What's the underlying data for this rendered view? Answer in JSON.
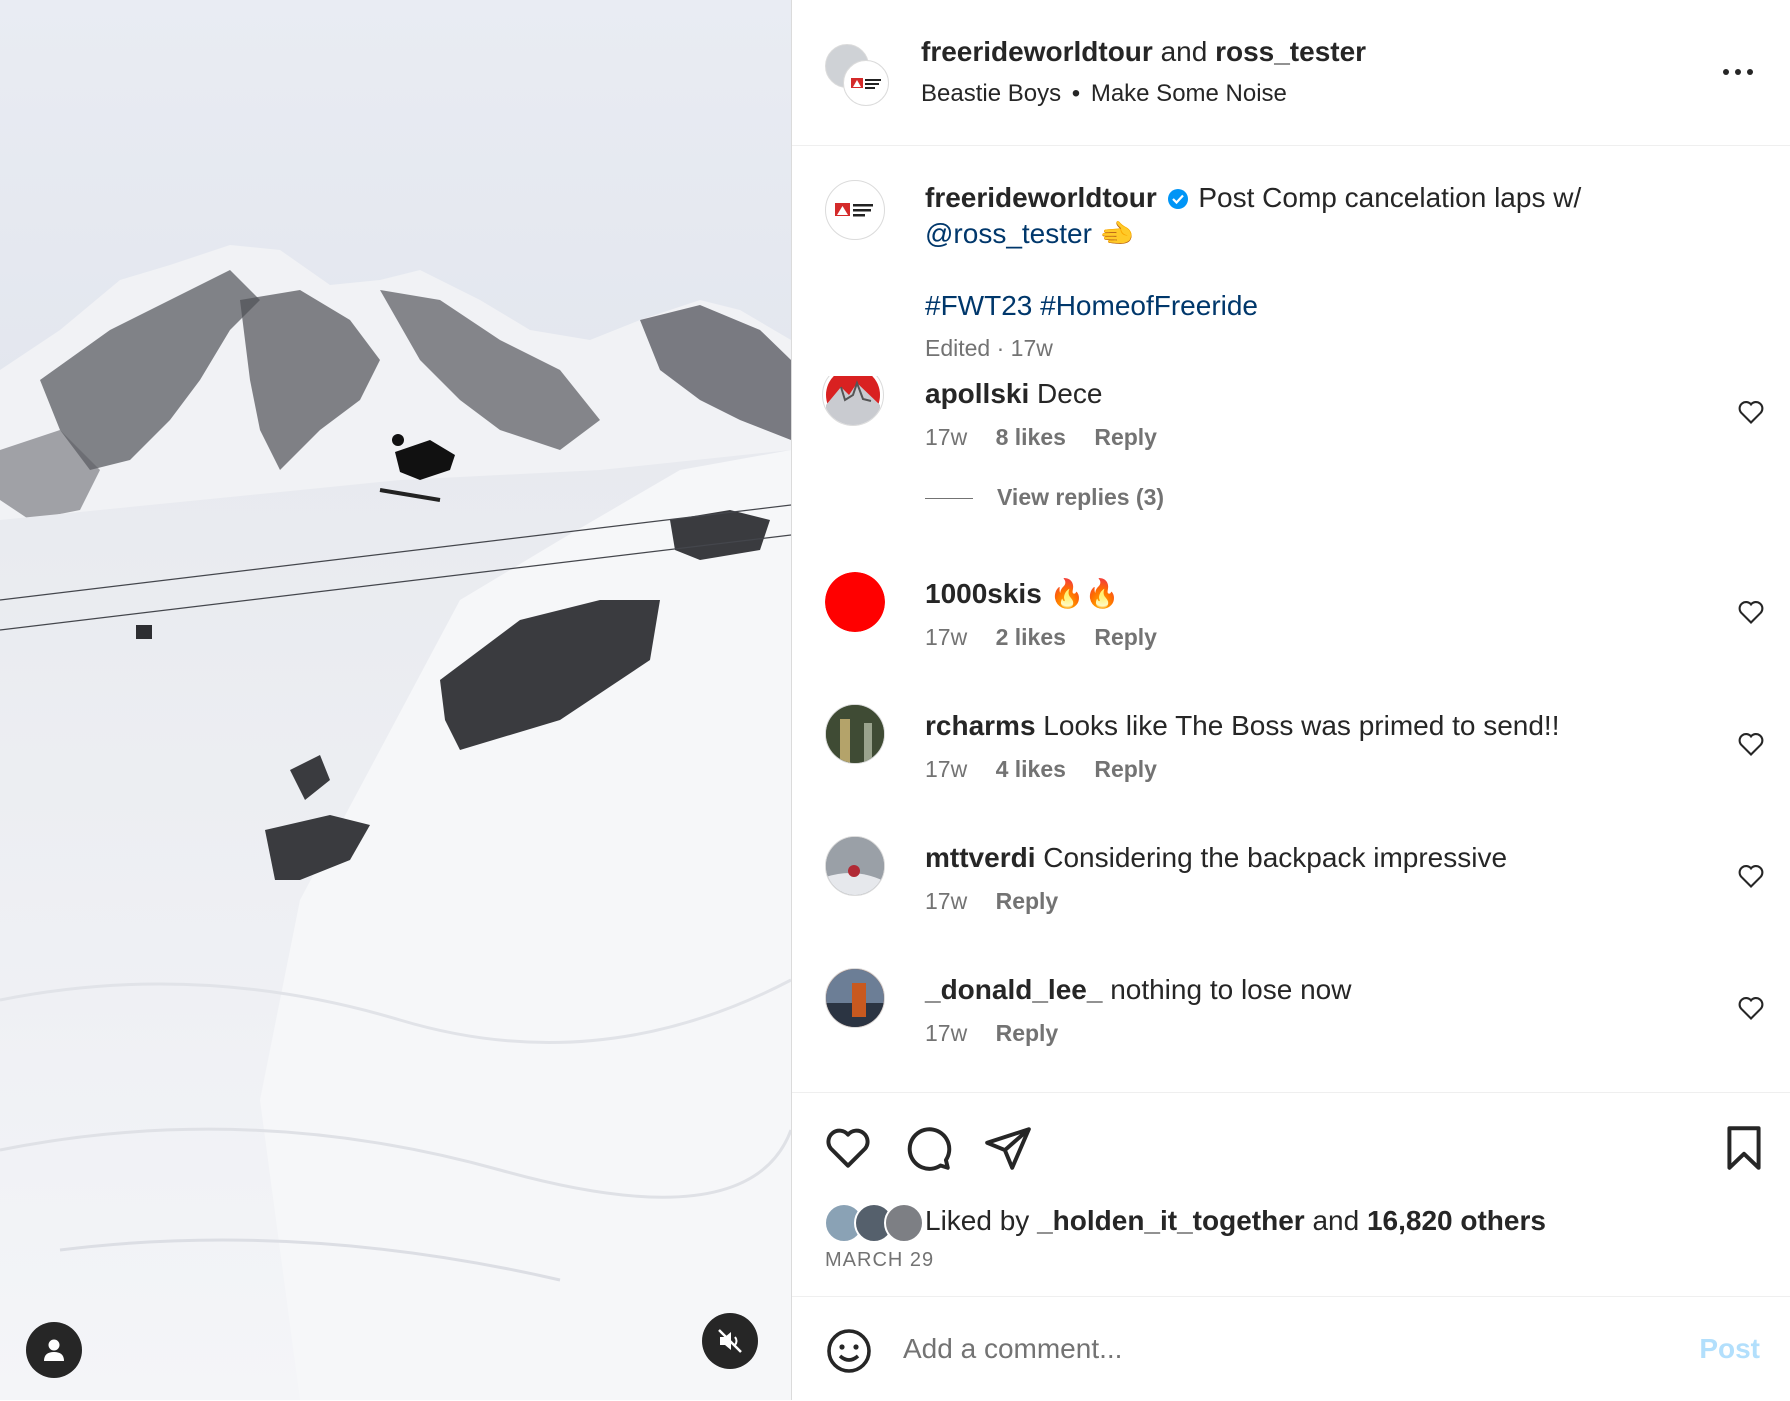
{
  "header": {
    "user1": "freerideworldtour",
    "conj": "and",
    "user2": "ross_tester",
    "artist": "Beastie Boys",
    "dot": "•",
    "song": "Make Some Noise",
    "more_icon": "more-horizontal-icon"
  },
  "caption": {
    "username": "freerideworldtour",
    "verified_icon": "verified-badge-icon",
    "text": "Post Comp cancelation laps w/",
    "mention": "@ross_tester",
    "emoji": "🫲",
    "hashtags": "#FWT23 #HomeofFreeride",
    "meta": "Edited · 17w"
  },
  "comments": [
    {
      "username": "apollski",
      "text": "Dece",
      "time": "17w",
      "likes": "8 likes",
      "reply": "Reply",
      "replies": "View replies (3)",
      "avatar_color": "#d92121"
    },
    {
      "username": "1000skis",
      "text": "🔥🔥",
      "time": "17w",
      "likes": "2 likes",
      "reply": "Reply",
      "avatar_color": "#ff0000"
    },
    {
      "username": "rcharms",
      "text": "Looks like The Boss was primed to send!!",
      "time": "17w",
      "likes": "4 likes",
      "reply": "Reply",
      "avatar_color": "#4a5a3a"
    },
    {
      "username": "mttverdi",
      "text": "Considering the backpack impressive",
      "time": "17w",
      "likes": "",
      "reply": "Reply",
      "avatar_color": "#8a8f96"
    },
    {
      "username": "_donald_lee_",
      "text": "nothing to lose now",
      "time": "17w",
      "likes": "",
      "reply": "Reply",
      "avatar_color": "#c8591f"
    }
  ],
  "actions": {
    "like_icon": "heart-icon",
    "comment_icon": "comment-icon",
    "share_icon": "send-icon",
    "save_icon": "bookmark-icon",
    "liked_prefix": "Liked by",
    "liked_user": "_holden_it_together",
    "liked_and": "and",
    "liked_others": "16,820 others",
    "date": "MARCH 29"
  },
  "add_comment": {
    "emoji_icon": "smiley-icon",
    "placeholder": "Add a comment...",
    "post_label": "Post"
  },
  "media": {
    "user_tag_icon": "user-icon",
    "mute_icon": "speaker-muted-icon"
  }
}
